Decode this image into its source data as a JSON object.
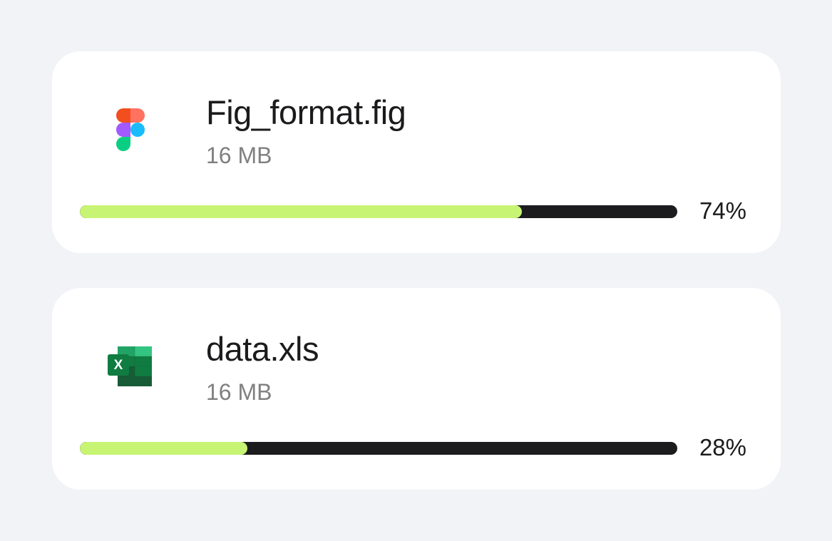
{
  "files": [
    {
      "icon": "figma-icon",
      "name": "Fig_format.fig",
      "size": "16 MB",
      "progress_label": "74%",
      "progress_fraction": 0.74
    },
    {
      "icon": "excel-icon",
      "name": "data.xls",
      "size": "16 MB",
      "progress_label": "28%",
      "progress_fraction": 0.28
    }
  ],
  "colors": {
    "background": "#f2f3f7",
    "card": "#ffffff",
    "progress_fill": "#c8f473",
    "progress_track": "#1c1c1e",
    "primary_text": "#1b1b1d",
    "secondary_text": "#808080"
  }
}
